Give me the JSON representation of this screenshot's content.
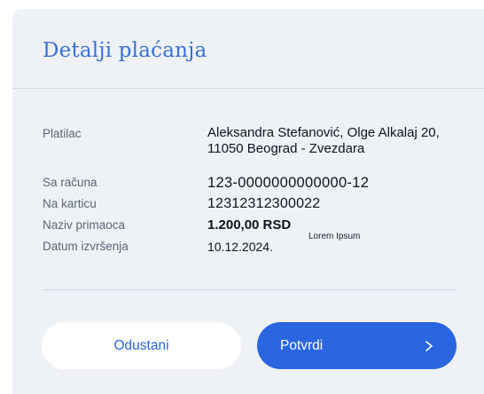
{
  "dialog": {
    "title": "Detalji plaćanja"
  },
  "details": {
    "payer": {
      "label": "Platilac",
      "value_line1": "Aleksandra Stefanović, Olge Alkalaj 20,",
      "value_line2": "11050 Beograd - Zvezdara"
    },
    "account": {
      "label": "Sa računa",
      "value": "123-0000000000000-12"
    },
    "card": {
      "label": "Na karticu",
      "value": "12312312300022"
    },
    "recipient": {
      "label": "Naziv primaoca",
      "value": "1.200,00 RSD"
    },
    "date": {
      "label": "Datum izvršenja",
      "value": "10.12.2024.",
      "note": "Lorem Ipsum"
    }
  },
  "actions": {
    "cancel_label": "Odustani",
    "confirm_label": "Potvrdi",
    "confirm_icon": "chevron-right-icon"
  },
  "colors": {
    "accent": "#2a66e0",
    "title": "#3a6fd4",
    "card_background": "#eef1f6"
  }
}
